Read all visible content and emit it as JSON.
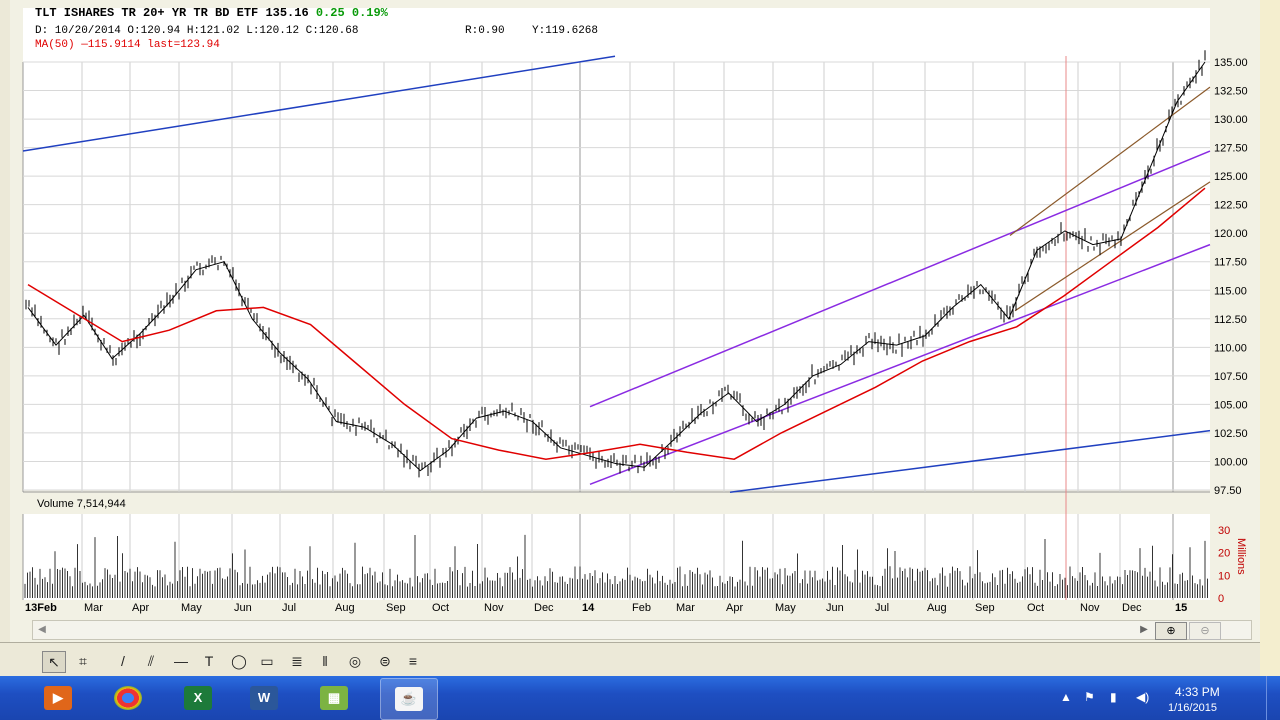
{
  "header": {
    "symbol_line": "TLT ISHARES TR 20+ YR TR BD ETF   135.16",
    "change": "0.25",
    "change_pct": "0.19%",
    "ohlc_line": "D: 10/20/2014  O:120.94  H:121.02  L:120.12  C:120.68",
    "r_value": "R:0.90",
    "y_value": "Y:119.6268",
    "ma_line": "MA(50) —115.9114 last=123.94"
  },
  "volume_label": "Volume 7,514,944",
  "colors": {
    "ma": "#e00000",
    "channel_purple": "#8a2be2",
    "trend_blue": "#2040c0",
    "brown": "#8b5a2b",
    "up_text": "#0a9b0a"
  },
  "chart_data": {
    "type": "line",
    "ylim": [
      97.5,
      135.0
    ],
    "y_ticks": [
      "135.00",
      "132.50",
      "130.00",
      "127.50",
      "125.00",
      "122.50",
      "120.00",
      "117.50",
      "115.00",
      "112.50",
      "110.00",
      "107.50",
      "105.00",
      "102.50",
      "100.00",
      "97.50"
    ],
    "x_labels": [
      "13Feb",
      "Mar",
      "Apr",
      "May",
      "Jun",
      "Jul",
      "Aug",
      "Sep",
      "Oct",
      "Nov",
      "Dec",
      "14",
      "Feb",
      "Mar",
      "Apr",
      "May",
      "Jun",
      "Jul",
      "Aug",
      "Sep",
      "Oct",
      "Nov",
      "Dec",
      "15"
    ],
    "volume_ticks": [
      "30",
      "20",
      "10",
      "0"
    ],
    "volume_unit": "Millions",
    "series": [
      {
        "values": [
          113.5,
          110.2,
          112.8,
          109.0,
          111.2,
          113.8,
          116.8,
          117.5,
          112.5,
          109.5,
          107.2,
          103.5,
          103.0,
          101.5,
          99.2,
          101.0,
          103.8,
          104.4,
          103.5,
          101.2,
          100.5,
          99.8,
          99.5,
          101.8,
          104.2,
          106.0,
          103.5,
          105.0,
          107.5,
          108.5,
          110.5,
          110.2,
          111.0,
          113.5,
          115.5,
          112.5,
          118.5,
          120.2,
          119.0,
          119.5,
          125.5,
          131.5,
          135.0
        ]
      },
      {
        "name": "MA(50)",
        "values": [
          115.5,
          113.0,
          110.5,
          111.5,
          113.2,
          113.5,
          112.0,
          108.5,
          105.0,
          102.0,
          101.0,
          100.2,
          100.8,
          101.5,
          100.8,
          100.2,
          102.5,
          104.5,
          106.5,
          108.8,
          110.5,
          111.8,
          114.5,
          117.5,
          120.5,
          123.94
        ]
      }
    ]
  },
  "toolbar": [
    "pointer",
    "crosshair",
    "pen",
    "parallel-lines",
    "horizontal-line",
    "text",
    "ellipse",
    "rectangle",
    "fibonacci",
    "gann",
    "cycle",
    "list"
  ],
  "taskbar": {
    "apps": [
      "media-player",
      "chrome",
      "excel",
      "word",
      "app",
      "java"
    ],
    "time": "4:33 PM",
    "date": "1/16/2015"
  }
}
